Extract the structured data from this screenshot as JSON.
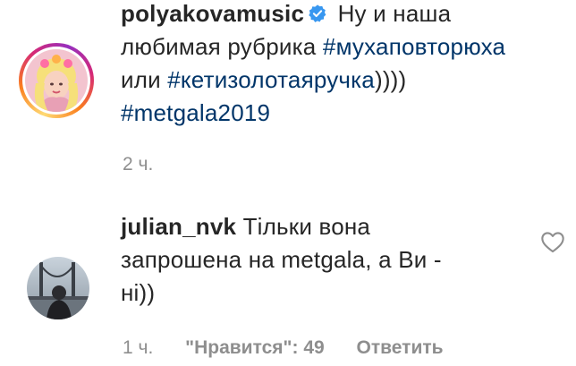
{
  "caption": {
    "username": "polyakovamusic",
    "verified_icon": "verified-badge-icon",
    "text_line1": "Ну и наша",
    "text_line2": "любимая рубрика",
    "hashtag1": "#мухаповторюха",
    "text_line3": "или",
    "hashtag2": "#кетизолотаяручка",
    "text_line3_end": "))))",
    "hashtag3": "#metgala2019",
    "time": "2 ч."
  },
  "reply": {
    "username": "julian_nvk",
    "text_line1": "Тільки вона",
    "text_line2": "запрошена на metgala, а Ви -",
    "text_line3": "ні))",
    "time": "1 ч.",
    "likes": "\"Нравится\": 49",
    "reply_label": "Ответить",
    "like_icon": "heart-outline-icon"
  },
  "colors": {
    "text": "#262626",
    "hashtag": "#003569",
    "meta": "#8e8e8e",
    "verified": "#3897f0"
  }
}
